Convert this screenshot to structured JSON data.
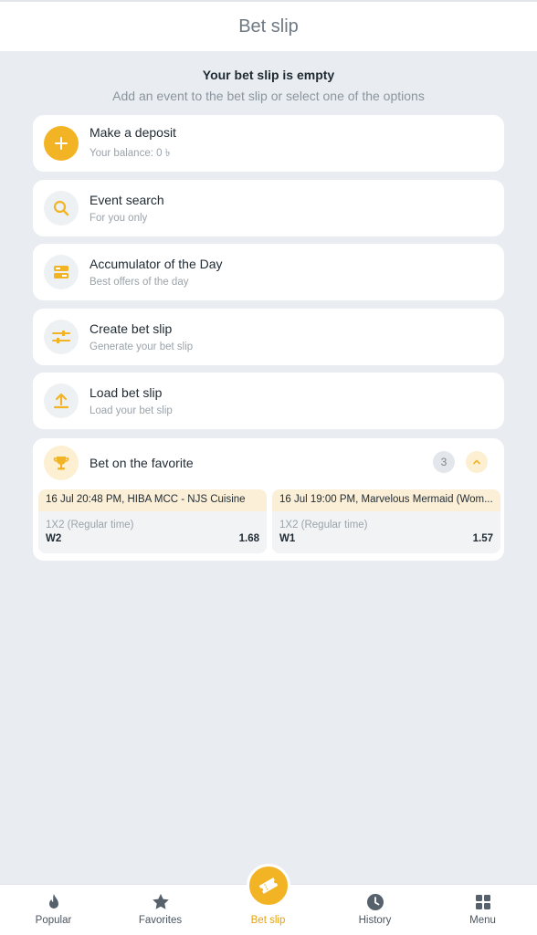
{
  "header": {
    "title": "Bet slip"
  },
  "empty": {
    "title": "Your bet slip is empty",
    "subtitle": "Add an event to the bet slip or select one of the options"
  },
  "options": [
    {
      "title": "Make a deposit",
      "subtitle": "Your balance: 0 ৳",
      "icon": "plus-icon"
    },
    {
      "title": "Event search",
      "subtitle": "For you only",
      "icon": "search-icon"
    },
    {
      "title": "Accumulator of the Day",
      "subtitle": "Best offers of the day",
      "icon": "accumulator-icon"
    },
    {
      "title": "Create bet slip",
      "subtitle": "Generate your bet slip",
      "icon": "sliders-icon"
    },
    {
      "title": "Load bet slip",
      "subtitle": "Load your bet slip",
      "icon": "upload-icon"
    }
  ],
  "favorite": {
    "title": "Bet on the favorite",
    "count": "3",
    "events": [
      {
        "header": "16 Jul 20:48 PM, HIBA MCC - NJS Cuisine",
        "market": "1X2 (Regular time)",
        "outcome": "W2",
        "odds": "1.68"
      },
      {
        "header": "16 Jul 19:00 PM, Marvelous Mermaid (Wom...",
        "market": "1X2 (Regular time)",
        "outcome": "W1",
        "odds": "1.57"
      }
    ]
  },
  "nav": {
    "items": [
      {
        "label": "Popular",
        "icon": "flame-icon"
      },
      {
        "label": "Favorites",
        "icon": "star-icon"
      },
      {
        "label": "Bet slip",
        "icon": "ticket-icon"
      },
      {
        "label": "History",
        "icon": "clock-icon"
      },
      {
        "label": "Menu",
        "icon": "grid-icon"
      }
    ]
  },
  "colors": {
    "accent": "#f2b425",
    "background": "#e9edf1",
    "card": "#ffffff",
    "active_label": "#e8a20f"
  }
}
